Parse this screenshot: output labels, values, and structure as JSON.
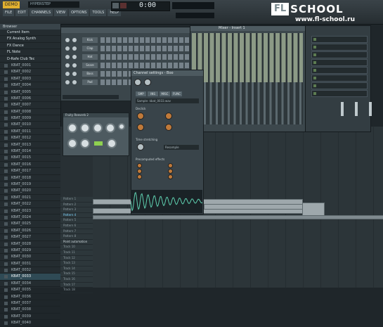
{
  "app": {
    "logo_text": "DEMO",
    "menu": [
      "FILE",
      "EDIT",
      "CHANNELS",
      "VIEW",
      "OPTIONS",
      "TOOLS",
      "HELP"
    ],
    "hint_text": "HYPERSTEP",
    "time_display": "0:00"
  },
  "watermark": {
    "fl": "FL",
    "school": "SCHOOL",
    "url": "www.fl-school.ru"
  },
  "browser": {
    "title": "Browser",
    "folders": [
      "Current Item",
      "FX Analog Synth",
      "FX Dance",
      "FL Note",
      "D-Rafe Club Tec"
    ],
    "samples": [
      "KBAT_0001",
      "KBAT_0002",
      "KBAT_0003",
      "KBAT_0004",
      "KBAT_0005",
      "KBAT_0006",
      "KBAT_0007",
      "KBAT_0008",
      "KBAT_0009",
      "KBAT_0010",
      "KBAT_0011",
      "KBAT_0012",
      "KBAT_0013",
      "KBAT_0014",
      "KBAT_0015",
      "KBAT_0016",
      "KBAT_0017",
      "KBAT_0018",
      "KBAT_0019",
      "KBAT_0020",
      "KBAT_0021",
      "KBAT_0022",
      "KBAT_0023",
      "KBAT_0024",
      "KBAT_0025",
      "KBAT_0026",
      "KBAT_0027",
      "KBAT_0028",
      "KBAT_0029",
      "KBAT_0030",
      "KBAT_0031",
      "KBAT_0032",
      "KBAT_0033",
      "KBAT_0034",
      "KBAT_0035",
      "KBAT_0036",
      "KBAT_0037",
      "KBAT_0038",
      "KBAT_0039",
      "KBAT_0040"
    ],
    "selected_index": 32
  },
  "step_sequencer": {
    "channels": [
      "Kick",
      "Clap",
      "Hat",
      "Snare",
      "Bass",
      "Pad"
    ]
  },
  "mixer": {
    "title": "Mixer - Insert 1"
  },
  "channel_settings": {
    "title": "Channel settings - Boo",
    "tabs": [
      "SMP",
      "INS",
      "MISC",
      "FUNC"
    ],
    "sample_field": "Sample: kbat_0033.wav",
    "section_labels": [
      "Declick",
      "Time stretching",
      "Precomputed effects"
    ],
    "mode_field": "Resample"
  },
  "playlist": {
    "tracks": [
      "Pattern 1",
      "Pattern 2",
      "Pattern 3",
      "Pattern 4",
      "Pattern 5",
      "Pattern 6",
      "Pattern 7",
      "Pattern 8"
    ],
    "sub_label": "Point automation",
    "lower_tracks": [
      "Track 10",
      "Track 11",
      "Track 12",
      "Track 13",
      "Track 14",
      "Track 15",
      "Track 16",
      "Track 17",
      "Track 18"
    ],
    "highlighted_track": 3
  },
  "plugin": {
    "title": "Fruity Reeverb 2"
  }
}
